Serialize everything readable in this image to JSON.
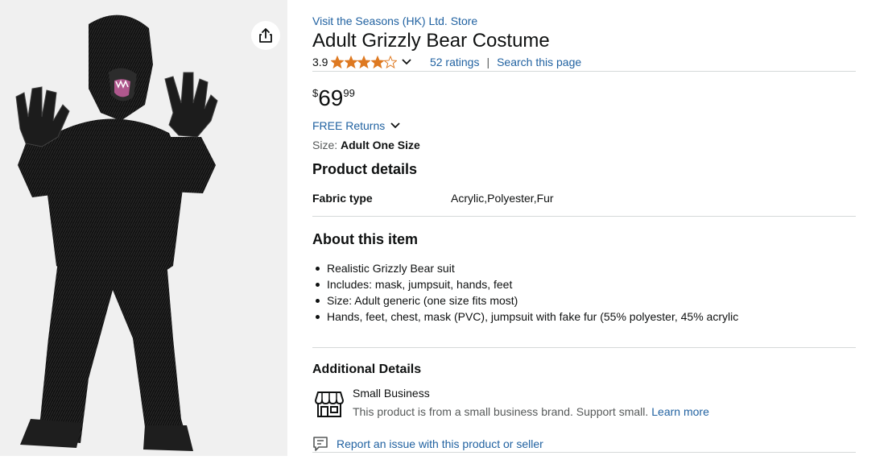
{
  "store": {
    "link_text": "Visit the Seasons (HK) Ltd. Store"
  },
  "product": {
    "title": "Adult Grizzly Bear Costume",
    "image_alt": "Adult Grizzly Bear Costume"
  },
  "rating": {
    "value": "3.9",
    "stars": 3.9,
    "ratings_text": "52 ratings",
    "separator": "|",
    "search_text": "Search this page"
  },
  "price": {
    "symbol": "$",
    "whole": "69",
    "fraction": "99"
  },
  "returns": {
    "label": "FREE Returns"
  },
  "size": {
    "label": "Size:",
    "value": "Adult One Size"
  },
  "product_details": {
    "heading": "Product details",
    "rows": [
      {
        "label": "Fabric type",
        "value": "Acrylic,Polyester,Fur"
      }
    ]
  },
  "about": {
    "heading": "About this item",
    "bullets": [
      "Realistic Grizzly Bear suit",
      "Includes: mask, jumpsuit, hands, feet",
      "Size: Adult generic (one size fits most)",
      "Hands, feet, chest, mask (PVC), jumpsuit with fake fur (55% polyester, 45% acrylic"
    ]
  },
  "additional": {
    "heading": "Additional Details",
    "badge_title": "Small Business",
    "badge_desc": "This product is from a small business brand. Support small.",
    "learn_more": "Learn more"
  },
  "report": {
    "text": "Report an issue with this product or seller"
  },
  "icons": {
    "share": "share-icon",
    "star": "star-icon",
    "chevron": "chevron-down-icon",
    "store": "storefront-icon",
    "report": "report-flag-icon"
  },
  "colors": {
    "link": "#2162a1",
    "star": "#de7921",
    "text": "#0f1111",
    "muted": "#565959",
    "divider": "#d5d9d9",
    "image_bg": "#f0f0f0"
  }
}
